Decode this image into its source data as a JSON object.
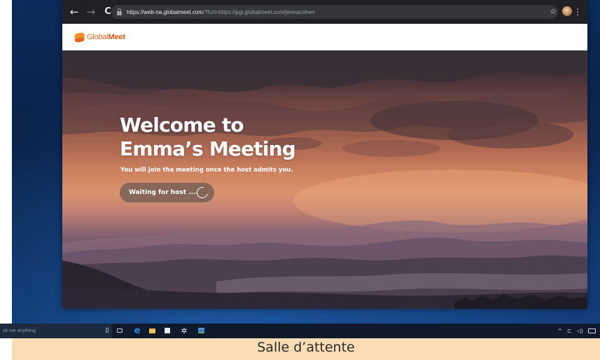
{
  "browser": {
    "url_main": "https://web-na.globalmeet.com",
    "url_rest": "/?furl=https://pgi.globalmeet.com/jennacohen",
    "back_glyph": "←",
    "forward_glyph": "→",
    "reload_glyph": "C",
    "star_glyph": "☆",
    "menu_glyph": "⋮",
    "icons": [
      "back-icon",
      "forward-icon",
      "reload-icon",
      "lock-icon",
      "star-icon",
      "profile-avatar",
      "kebab-menu-icon"
    ]
  },
  "header": {
    "logo_part1": "Global",
    "logo_part2": "Meet",
    "logo_colors": [
      "#f39325",
      "#e1661e"
    ]
  },
  "hero": {
    "title_line1": "Welcome to",
    "title_line2": "Emma’s Meeting",
    "subtitle": "You will join the meeting once the host admits you.",
    "status_label": "Waiting for host ....",
    "status_icon": "spinner-icon"
  },
  "taskbar": {
    "search_placeholder": "sk me anything",
    "edge_glyph": "e",
    "settings_glyph": "✲",
    "tray_up_glyph": "^",
    "tray_network_glyph": "⊏",
    "tray_volume_glyph": "◁)",
    "icons": [
      "mic-icon",
      "task-view-icon",
      "edge-icon",
      "file-explorer-icon",
      "store-icon",
      "settings-icon",
      "photos-icon",
      "tray-up-icon",
      "network-icon",
      "volume-icon",
      "keyboard-icon"
    ]
  },
  "caption": {
    "text": "Salle d’attente"
  }
}
